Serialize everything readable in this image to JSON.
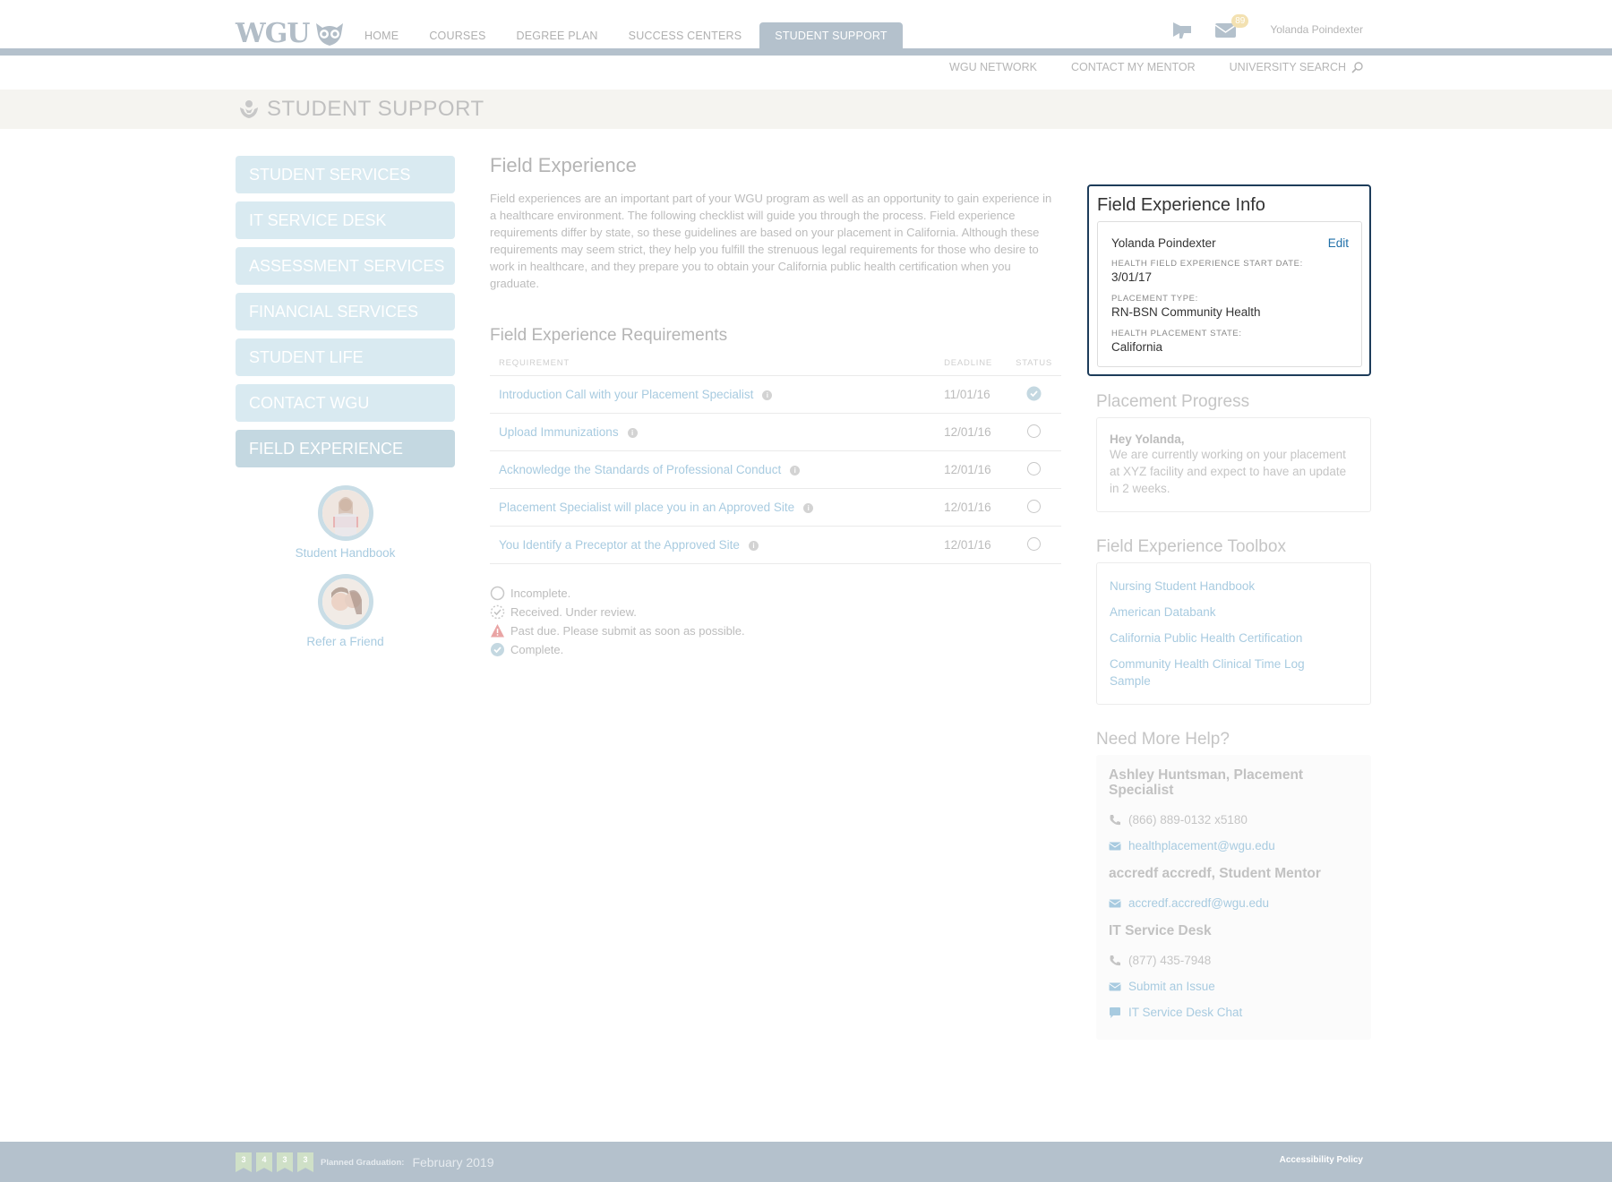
{
  "header": {
    "logo_text": "WGU",
    "nav": [
      {
        "label": "HOME",
        "active": false
      },
      {
        "label": "COURSES",
        "active": false
      },
      {
        "label": "DEGREE PLAN",
        "active": false
      },
      {
        "label": "SUCCESS CENTERS",
        "active": false
      },
      {
        "label": "STUDENT SUPPORT",
        "active": true
      }
    ],
    "icons": [
      "megaphone-icon",
      "mail-icon"
    ],
    "mail_badge": "89",
    "user_name": "Yolanda Poindexter",
    "subnav": [
      "WGU NETWORK",
      "CONTACT MY MENTOR",
      "UNIVERSITY SEARCH"
    ]
  },
  "band": {
    "title": "STUDENT SUPPORT",
    "icon": "hands-person-icon"
  },
  "sidebar": {
    "items": [
      {
        "label": "STUDENT SERVICES",
        "active": false
      },
      {
        "label": "IT SERVICE DESK",
        "active": false
      },
      {
        "label": "ASSESSMENT SERVICES",
        "active": false
      },
      {
        "label": "FINANCIAL SERVICES",
        "active": false
      },
      {
        "label": "STUDENT LIFE",
        "active": false
      },
      {
        "label": "CONTACT WGU",
        "active": false
      },
      {
        "label": "FIELD EXPERIENCE",
        "active": true
      }
    ],
    "promos": [
      {
        "label": "Student Handbook"
      },
      {
        "label": "Refer a Friend"
      }
    ]
  },
  "main": {
    "title": "Field Experience",
    "intro": "Field experiences are an important part of your WGU program as well as an opportunity to gain experience in a healthcare environment. The following checklist will guide you through the process. Field experience requirements differ by state, so these guidelines are based on your placement in California. Although these requirements may seem strict, they help you fulfill the strenuous legal requirements for those who desire to work in healthcare, and they prepare you to obtain your California public health certification when you graduate.",
    "requirements_title": "Field Experience Requirements",
    "columns": [
      "REQUIREMENT",
      "DEADLINE",
      "STATUS"
    ],
    "requirements": [
      {
        "name": "Introduction Call with your Placement Specialist",
        "deadline": "11/01/16",
        "status": "complete"
      },
      {
        "name": "Upload Immunizations",
        "deadline": "12/01/16",
        "status": "incomplete"
      },
      {
        "name": "Acknowledge the Standards of Professional Conduct",
        "deadline": "12/01/16",
        "status": "incomplete"
      },
      {
        "name": "Placement Specialist will place you in an Approved Site",
        "deadline": "12/01/16",
        "status": "incomplete"
      },
      {
        "name": "You Identify a Preceptor at the Approved Site",
        "deadline": "12/01/16",
        "status": "incomplete"
      }
    ],
    "legend": [
      {
        "icon": "incomplete",
        "label": "Incomplete."
      },
      {
        "icon": "received",
        "label": "Received. Under review."
      },
      {
        "icon": "past-due",
        "label": "Past due. Please submit as soon as possible."
      },
      {
        "icon": "complete",
        "label": "Complete."
      }
    ]
  },
  "info": {
    "title": "Field Experience Info",
    "name": "Yolanda Poindexter",
    "edit_label": "Edit",
    "fields": [
      {
        "label": "HEALTH FIELD EXPERIENCE START DATE:",
        "value": "3/01/17"
      },
      {
        "label": "PLACEMENT TYPE:",
        "value": "RN-BSN Community Health"
      },
      {
        "label": "HEALTH PLACEMENT STATE:",
        "value": "California"
      }
    ]
  },
  "progress": {
    "title": "Placement Progress",
    "greeting": "Hey Yolanda,",
    "message": "We are currently working on your placement at XYZ facility and expect to have an update in 2 weeks."
  },
  "toolbox": {
    "title": "Field Experience Toolbox",
    "links": [
      "Nursing Student Handbook",
      "American Databank",
      "California Public Health Certification",
      "Community Health Clinical Time Log Sample"
    ]
  },
  "help": {
    "title": "Need More Help?",
    "contacts": [
      {
        "name": "Ashley Huntsman, Placement Specialist",
        "phone": "(866) 889-0132 x5180",
        "email": "healthplacement@wgu.edu"
      },
      {
        "name": "accredf accredf, Student Mentor",
        "email": "accredf.accredf@wgu.edu"
      },
      {
        "name": "IT Service Desk",
        "phone": "(877) 435-7948",
        "email_link": "Submit an Issue",
        "chat_link": "IT Service Desk Chat"
      }
    ]
  },
  "footer": {
    "ribbons": [
      "3",
      "4",
      "3",
      "3"
    ],
    "grad_label": "Planned Graduation:",
    "grad_value": "February 2019",
    "policy_link": "Accessibility Policy"
  },
  "colors": {
    "accent_nav": "#b4c1cc",
    "sidebar_bg": "#d9eaf1",
    "sidebar_active": "#c4d8e1",
    "link": "#a8cbe0",
    "info_border": "#1d3c5a",
    "edit_link": "#1f6fa8",
    "badge": "#f3e1b1",
    "past_due": "#e9a4a4"
  }
}
